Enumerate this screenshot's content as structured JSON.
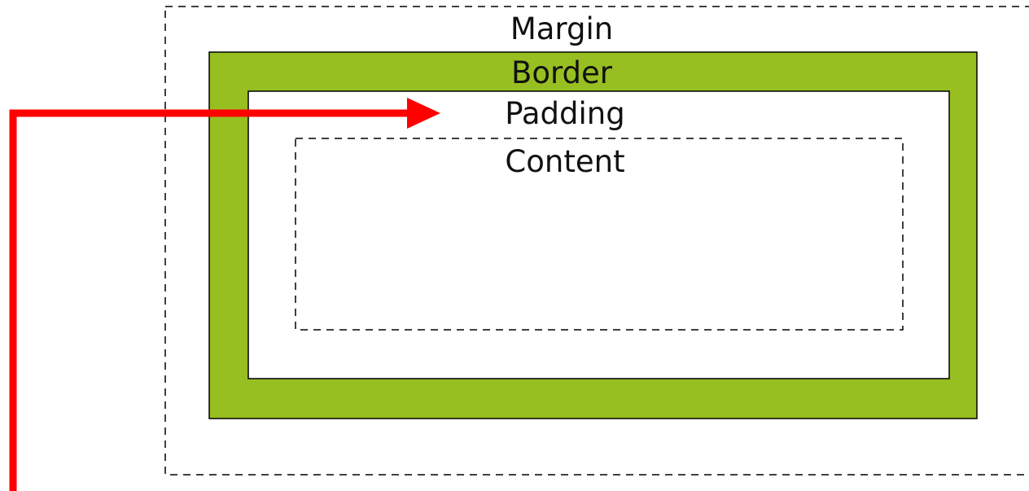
{
  "labels": {
    "margin": "Margin",
    "border": "Border",
    "padding": "Padding",
    "content": "Content"
  },
  "colors": {
    "border_fill": "#97bf22",
    "arrow": "#ff0000",
    "outline": "#000000",
    "background": "#ffffff"
  }
}
